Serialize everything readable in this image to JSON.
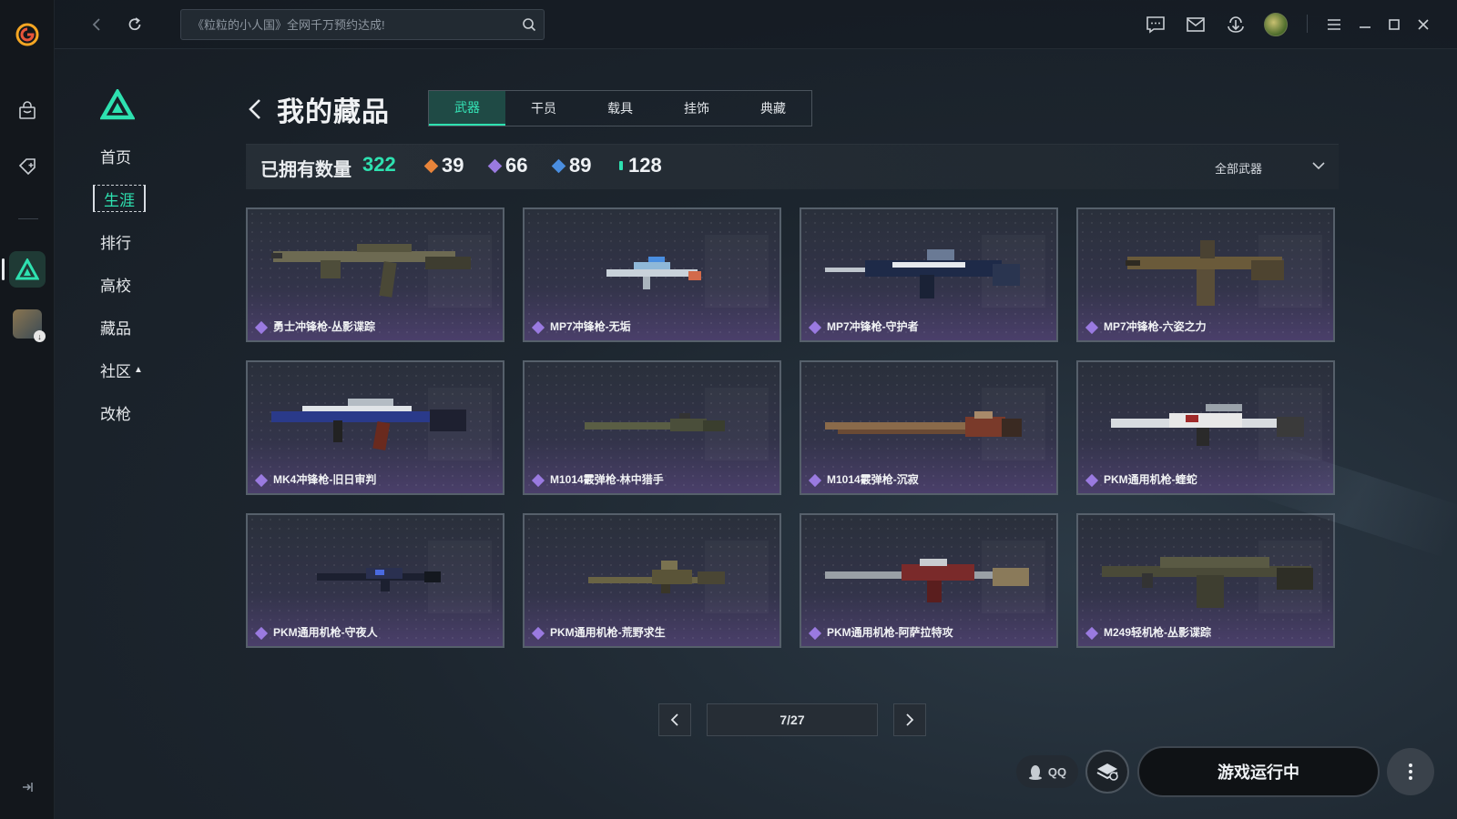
{
  "app": {
    "search_placeholder": "《粒粒的小人国》全网千万预约达成!"
  },
  "sidenav": {
    "items": [
      {
        "label": "首页"
      },
      {
        "label": "生涯"
      },
      {
        "label": "排行"
      },
      {
        "label": "高校"
      },
      {
        "label": "藏品"
      },
      {
        "label": "社区"
      },
      {
        "label": "改枪"
      }
    ],
    "active": "生涯"
  },
  "header": {
    "title": "我的藏品",
    "tabs": [
      {
        "label": "武器"
      },
      {
        "label": "干员"
      },
      {
        "label": "载具"
      },
      {
        "label": "挂饰"
      },
      {
        "label": "典藏"
      }
    ],
    "active_tab": "武器"
  },
  "stats": {
    "owned_label": "已拥有数量",
    "owned_total": "322",
    "rarities": [
      {
        "count": "39",
        "color": "#e8843a"
      },
      {
        "count": "66",
        "color": "#9a7ae0"
      },
      {
        "count": "89",
        "color": "#4a8ee0"
      },
      {
        "count": "128",
        "color": "#2ee1b0"
      }
    ],
    "filter_label": "全部武器"
  },
  "items": [
    {
      "name": "勇士冲锋枪-丛影谍踪"
    },
    {
      "name": "MP7冲锋枪-无垢"
    },
    {
      "name": "MP7冲锋枪-守护者"
    },
    {
      "name": "MP7冲锋枪-六姿之力"
    },
    {
      "name": "MK4冲锋枪-旧日审判"
    },
    {
      "name": "M1014霰弹枪-林中猎手"
    },
    {
      "name": "M1014霰弹枪-沉寂"
    },
    {
      "name": "PKM通用机枪-蝰蛇"
    },
    {
      "name": "PKM通用机枪-守夜人"
    },
    {
      "name": "PKM通用机枪-荒野求生"
    },
    {
      "name": "PKM通用机枪-阿萨拉特攻"
    },
    {
      "name": "M249轻机枪-丛影谍踪"
    }
  ],
  "pagination": {
    "current": "7/27"
  },
  "actions": {
    "qq_label": "QQ",
    "run_label": "游戏运行中"
  },
  "colors": {
    "accent": "#2ee1b0",
    "rarity_epic": "#9a7ae0"
  }
}
